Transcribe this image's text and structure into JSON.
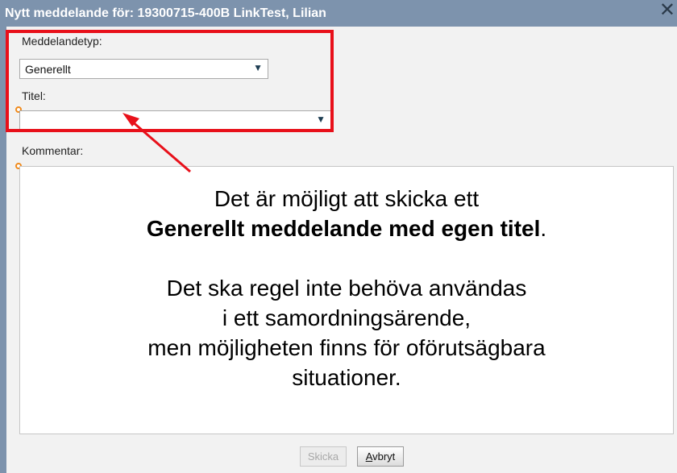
{
  "window": {
    "title": "Nytt meddelande för: 19300715-400B LinkTest, Lilian",
    "close_glyph": "✕"
  },
  "form": {
    "message_type_label": "Meddelandetyp:",
    "message_type_value": "Generellt",
    "title_label": "Titel:",
    "title_value": "",
    "comment_label": "Kommentar:"
  },
  "annotation": {
    "line1": "Det är möjligt att skicka ett",
    "line2_bold": "Generellt meddelande med egen titel",
    "line2_tail": ".",
    "line3": "Det ska regel inte behöva användas",
    "line4": "i ett samordningsärende,",
    "line5": "men möjligheten finns för oförutsägbara",
    "line6": "situationer.",
    "highlight_color": "#e8101a"
  },
  "buttons": {
    "send_label": "Skicka",
    "cancel_first_letter": "A",
    "cancel_rest": "vbryt"
  },
  "colors": {
    "titlebar": "#7d93ad",
    "required_marker": "#f08a1c",
    "annotation_red": "#e8101a"
  }
}
